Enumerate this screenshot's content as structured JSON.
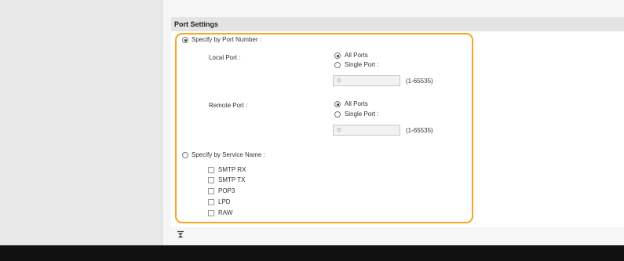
{
  "port_settings": {
    "title": "Port Settings",
    "specify_by_port_number": {
      "label": "Specify by Port Number :",
      "selected": true
    },
    "local_port": {
      "label": "Local Port :",
      "all_ports": {
        "label": "All Ports",
        "selected": true
      },
      "single_port": {
        "label": "Single Port :",
        "selected": false
      },
      "input_value": "0",
      "range": "(1-65535)"
    },
    "remote_port": {
      "label": "Remote Port :",
      "all_ports": {
        "label": "All Ports",
        "selected": true
      },
      "single_port": {
        "label": "Single Port :",
        "selected": false
      },
      "input_value": "0",
      "range": "(1-65535)"
    },
    "specify_by_service_name": {
      "label": "Specify by Service Name :",
      "selected": false
    },
    "services": [
      {
        "label": "SMTP RX",
        "checked": false
      },
      {
        "label": "SMTP TX",
        "checked": false
      },
      {
        "label": "POP3",
        "checked": false
      },
      {
        "label": "LPD",
        "checked": false
      },
      {
        "label": "RAW",
        "checked": false
      }
    ]
  },
  "highlight_color": "#f5a623",
  "icons": {
    "footer": "jump-to-top-icon"
  }
}
